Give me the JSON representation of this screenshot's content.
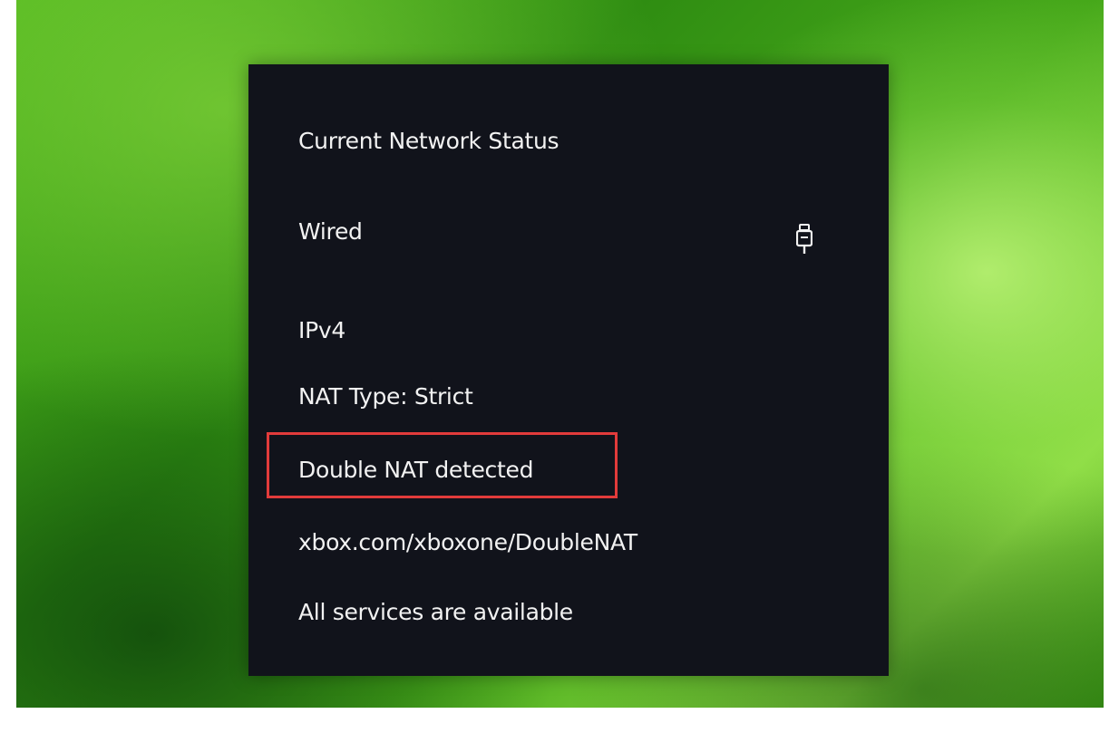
{
  "panel": {
    "title": "Current Network Status",
    "connection": {
      "type_label": "Wired",
      "icon": "ethernet-plug-icon"
    },
    "protocol": "IPv4",
    "nat_type": "NAT Type: Strict",
    "warning": "Double NAT detected",
    "help_link": "xbox.com/xboxone/DoubleNAT",
    "services_status": "All services are available"
  },
  "colors": {
    "panel_background": "#11131b",
    "text": "#f2f2f2",
    "highlight_border": "#e23b3b",
    "background_green": "#4fb51e"
  }
}
